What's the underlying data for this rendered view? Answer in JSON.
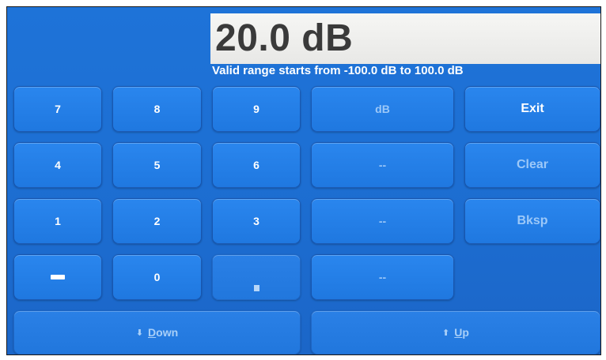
{
  "display": {
    "value": "20.0 dB",
    "range_text": "Valid range starts from -100.0 dB to 100.0 dB"
  },
  "keypad": {
    "k7": "7",
    "k8": "8",
    "k9": "9",
    "k4": "4",
    "k5": "5",
    "k6": "6",
    "k1": "1",
    "k2": "2",
    "k3": "3",
    "k0": "0"
  },
  "units": {
    "db": "dB",
    "slot2": "--",
    "slot3": "--",
    "slot4": "--"
  },
  "actions": {
    "exit": "Exit",
    "clear": "Clear",
    "bksp": "Bksp"
  },
  "nav": {
    "down": "Down",
    "up": "Up"
  }
}
